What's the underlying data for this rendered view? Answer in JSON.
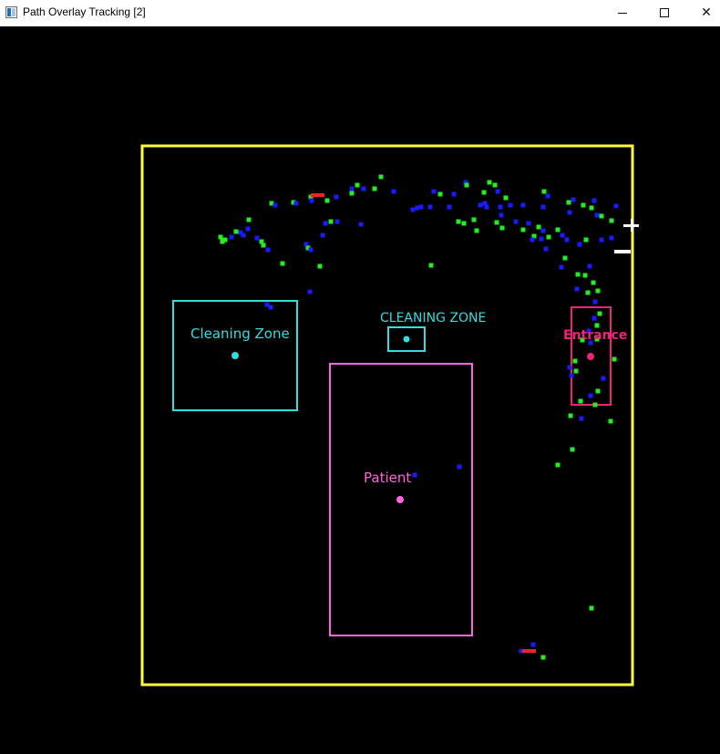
{
  "window": {
    "title": "Path Overlay Tracking [2]",
    "icon": "app-window-icon",
    "controls": [
      "minimize-icon",
      "maximize-icon",
      "close-icon"
    ]
  },
  "colors": {
    "boundary": "#ffff33",
    "cleaning": "#33dddd",
    "patient": "#ff66dd",
    "entrance": "#ee2277",
    "pointGreen": "#22ee22",
    "pointBlue": "#1a1aff",
    "marker": "#ee2222",
    "white": "#ffffff"
  },
  "overlay": {
    "zones": {
      "cleaning_left_label": "Cleaning Zone",
      "cleaning_small_label": "CLEANING ZONE",
      "patient_label": "Patient",
      "entrance_label": "Entrance"
    }
  }
}
